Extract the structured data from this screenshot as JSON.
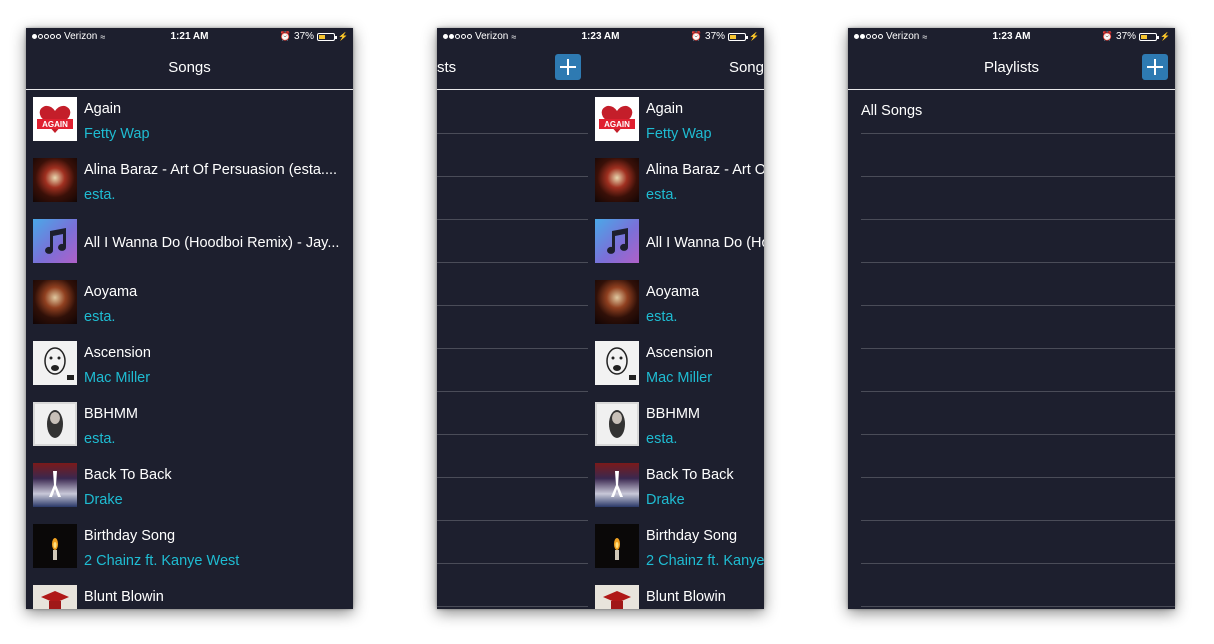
{
  "status": {
    "carrier": "Verizon",
    "battery": "37%",
    "battery_level": 0.37
  },
  "screens": [
    {
      "time": "1:21 AM",
      "title": "Songs"
    },
    {
      "time": "1:23 AM",
      "title_left": "sts",
      "title_right": "Song"
    },
    {
      "time": "1:23 AM",
      "title": "Playlists"
    }
  ],
  "songs": [
    {
      "title": "Again",
      "artist": "Fetty Wap",
      "art": "album-art-again"
    },
    {
      "title": "Alina Baraz - Art Of Persuasion (esta....",
      "artist": "esta.",
      "art": "album-art-crowd"
    },
    {
      "title": "All I Wanna Do (Hoodboi Remix) - Jay...",
      "artist": "",
      "art": "music-note-icon"
    },
    {
      "title": "Aoyama",
      "artist": "esta.",
      "art": "album-art-crowd"
    },
    {
      "title": "Ascension",
      "artist": "Mac Miller",
      "art": "album-art-mac-miller"
    },
    {
      "title": "BBHMM",
      "artist": "esta.",
      "art": "album-art-bbhmm"
    },
    {
      "title": "Back To Back",
      "artist": "Drake",
      "art": "album-art-drake"
    },
    {
      "title": "Birthday Song",
      "artist": "2 Chainz ft. Kanye West",
      "art": "album-art-candle"
    },
    {
      "title": "Blunt Blowin",
      "artist": "",
      "art": "album-art-blunt"
    }
  ],
  "screen2_songs": [
    {
      "title": "Again",
      "artist": "Fetty Wap"
    },
    {
      "title": "Alina Baraz - Art O",
      "artist": "esta."
    },
    {
      "title": "All I Wanna Do (Ho",
      "artist": ""
    },
    {
      "title": "Aoyama",
      "artist": "esta."
    },
    {
      "title": "Ascension",
      "artist": "Mac Miller"
    },
    {
      "title": "BBHMM",
      "artist": "esta."
    },
    {
      "title": "Back To Back",
      "artist": "Drake"
    },
    {
      "title": "Birthday Song",
      "artist": "2 Chainz ft. Kanye"
    },
    {
      "title": "Blunt Blowin",
      "artist": ""
    }
  ],
  "playlists": [
    {
      "label": "All Songs"
    }
  ],
  "colors": {
    "background": "#1d1f2e",
    "accent": "#1fbcd2",
    "add_button": "#2e7ab2"
  }
}
